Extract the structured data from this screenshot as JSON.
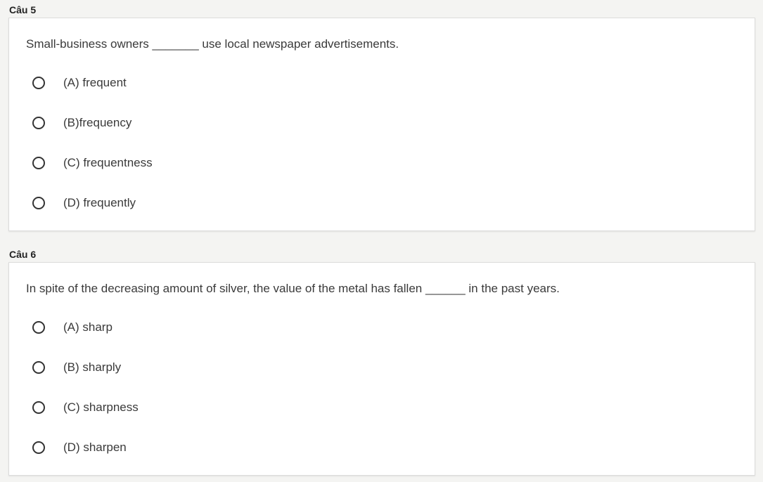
{
  "questions": [
    {
      "title": "Câu 5",
      "prompt": "Small-business owners _______ use local newspaper advertisements.",
      "options": [
        "(A) frequent",
        "(B)frequency",
        "(C) frequentness",
        "(D) frequently"
      ]
    },
    {
      "title": "Câu 6",
      "prompt": "In spite of the decreasing amount of silver, the value of the metal has fallen ______ in the past years.",
      "options": [
        "(A) sharp",
        "(B) sharply",
        "(C) sharpness",
        "(D) sharpen"
      ]
    }
  ]
}
